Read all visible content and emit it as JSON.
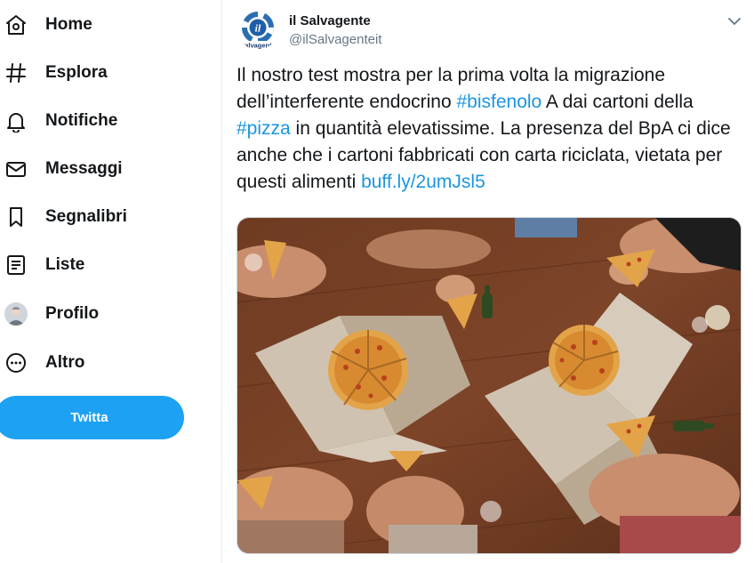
{
  "sidebar": {
    "items": [
      {
        "label": "Home",
        "icon": "home-icon"
      },
      {
        "label": "Esplora",
        "icon": "hashtag-icon"
      },
      {
        "label": "Notifiche",
        "icon": "bell-icon"
      },
      {
        "label": "Messaggi",
        "icon": "envelope-icon"
      },
      {
        "label": "Segnalibri",
        "icon": "bookmark-icon"
      },
      {
        "label": "Liste",
        "icon": "list-icon"
      },
      {
        "label": "Profilo",
        "icon": "avatar"
      },
      {
        "label": "Altro",
        "icon": "more-circle-icon"
      }
    ],
    "tweet_button": "Twitta"
  },
  "tweet": {
    "author_name": "il Salvagente",
    "author_handle": "@ilSalvagenteit",
    "avatar_logo_text": "il",
    "avatar_logo_subtext": "Salvagente",
    "text": {
      "p1": "Il nostro test mostra per la prima volta la migrazione dell’interferente endocrino ",
      "hashtag1": "#bisfenolo",
      "p2": " A dai cartoni della ",
      "hashtag2": "#pizza",
      "p3": " in quantità elevatissime. La presenza del BpA ci dice anche che i cartoni fabbricati con carta riciclata, vietata per questi alimenti ",
      "link": "buff.ly/2umJsl5"
    },
    "media_description": "pizza-boxes-photo"
  },
  "colors": {
    "accent": "#1da1f2",
    "link": "#1b95e0",
    "text": "#14171a",
    "secondary": "#657786"
  }
}
